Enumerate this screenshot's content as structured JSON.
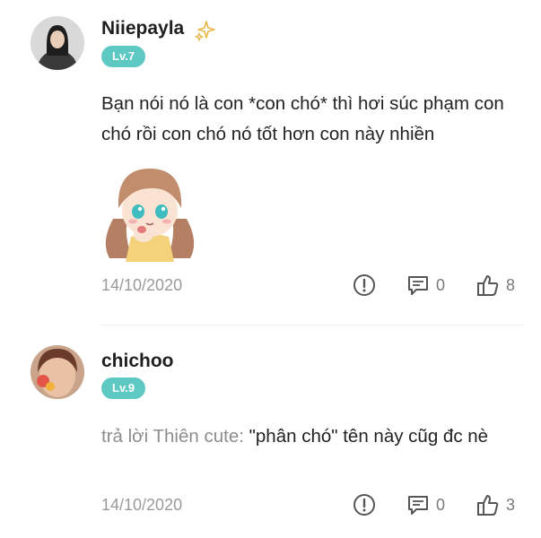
{
  "comments": [
    {
      "username": "Niiepayla",
      "level": "Lv.7",
      "text": "Bạn nói nó là con *con chó* thì hơi súc phạm con chó rồi con chó nó tốt hơn con này nhiền",
      "date": "14/10/2020",
      "reply_count": "0",
      "like_count": "8",
      "avatar_icon": "avatar-photo",
      "badge_icon": "sparkle-icon",
      "sticker_icon": "anime-girl-sticker"
    },
    {
      "username": "chichoo",
      "level": "Lv.9",
      "reply_prefix": "trả lời Thiên cute:",
      "text": "\"phân chó\" tên này cũg đc nè",
      "date": "14/10/2020",
      "reply_count": "0",
      "like_count": "3",
      "avatar_icon": "avatar-photo"
    }
  ],
  "colors": {
    "level_badge": "#5ec9c3",
    "sparkle": "#e8b84a",
    "text": "#222222",
    "muted": "#9a9a9a"
  }
}
